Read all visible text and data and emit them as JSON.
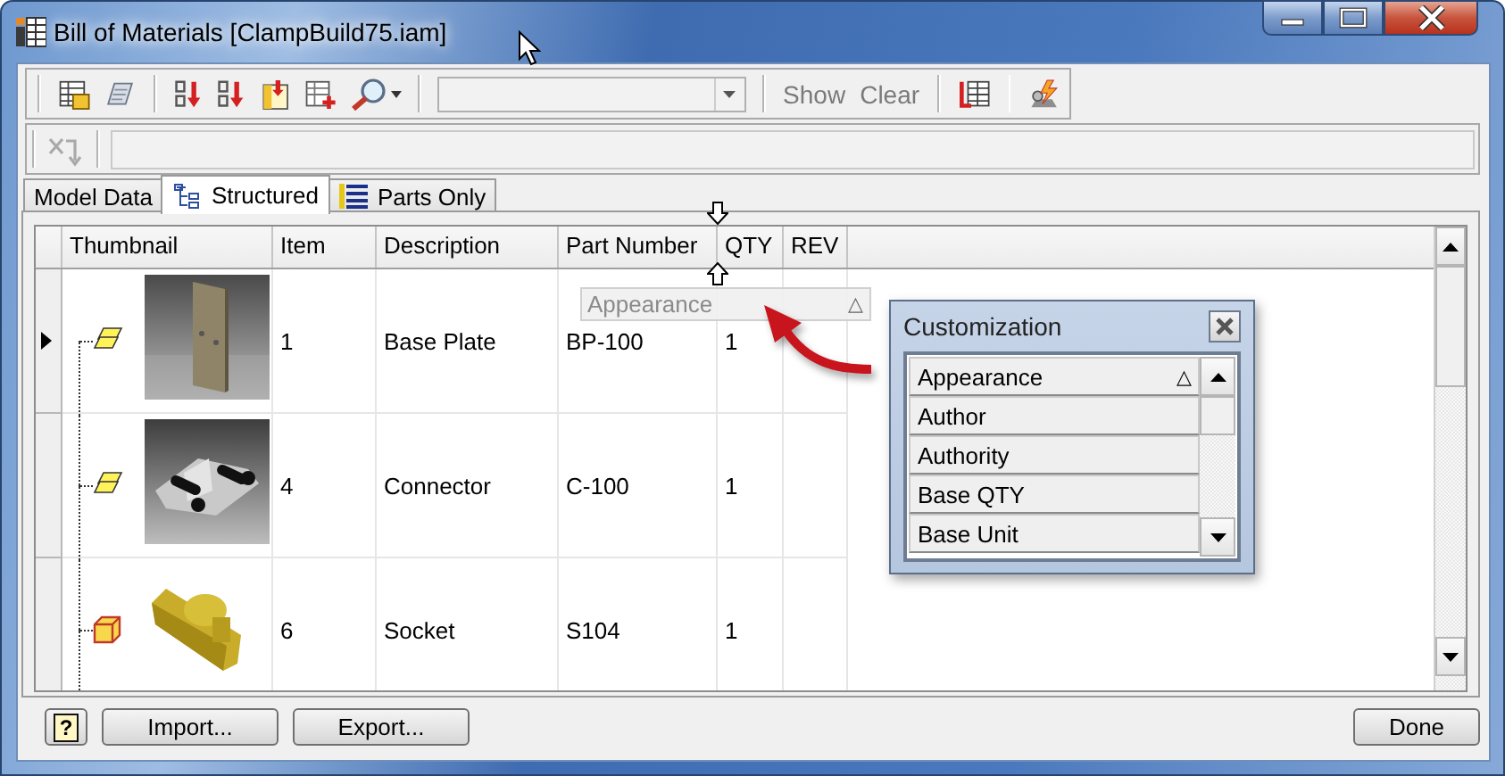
{
  "window": {
    "title": "Bill of Materials [ClampBuild75.iam]"
  },
  "toolbar": {
    "buttons": [
      {
        "label": "Show",
        "disabled": true
      },
      {
        "label": "Clear",
        "disabled": true
      }
    ]
  },
  "formula_bar": {
    "disabled": true
  },
  "tabs": [
    {
      "label": "Model Data",
      "kind": "plain",
      "selected": false
    },
    {
      "label": "Structured",
      "kind": "tree",
      "selected": true
    },
    {
      "label": "Parts Only",
      "kind": "list",
      "selected": false
    }
  ],
  "table": {
    "columns": [
      "Thumbnail",
      "Item",
      "Description",
      "Part Number",
      "QTY",
      "REV"
    ],
    "rows": [
      {
        "selected": true,
        "kind": "sheet",
        "item": "1",
        "description": "Base Plate",
        "part_number": "BP-100",
        "qty": "1"
      },
      {
        "selected": false,
        "kind": "sheet",
        "item": "4",
        "description": "Connector",
        "part_number": "C-100",
        "qty": "1"
      },
      {
        "selected": false,
        "kind": "solid",
        "item": "6",
        "description": "Socket",
        "part_number": "S104",
        "qty": "1"
      }
    ]
  },
  "dragged_header": {
    "label": "Appearance",
    "sort_mark": "△"
  },
  "customization": {
    "title": "Customization",
    "fields": [
      {
        "label": "Appearance",
        "sort_mark": "△"
      },
      {
        "label": "Author"
      },
      {
        "label": "Authority"
      },
      {
        "label": "Base QTY"
      },
      {
        "label": "Base Unit"
      }
    ]
  },
  "footer_buttons": [
    {
      "kind": "help",
      "label": "?"
    },
    {
      "kind": "left",
      "label": "Import..."
    },
    {
      "kind": "left",
      "label": "Export..."
    },
    {
      "kind": "right",
      "label": "Done"
    }
  ]
}
